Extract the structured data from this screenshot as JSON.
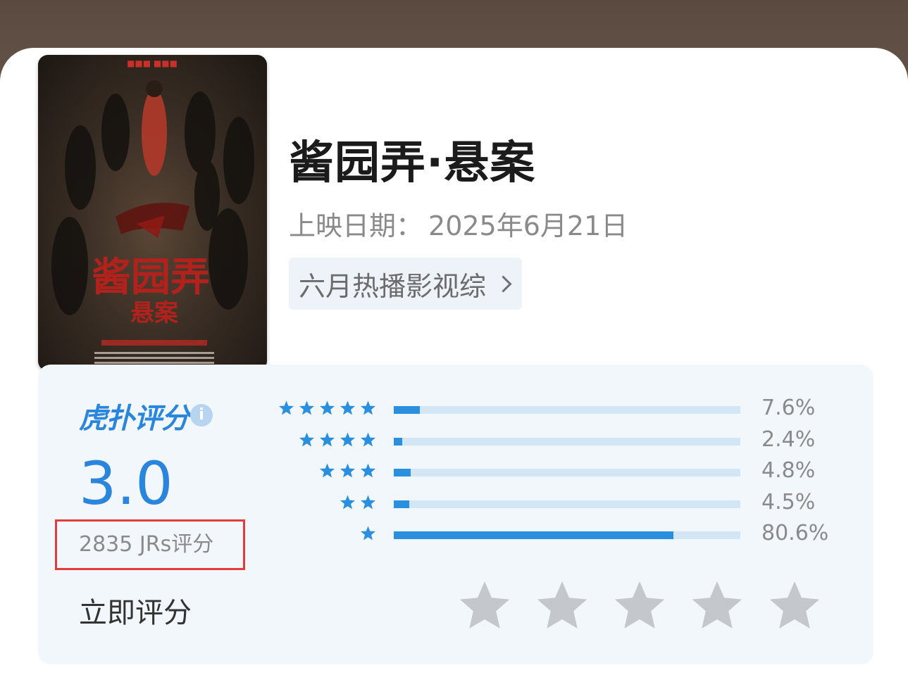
{
  "movie": {
    "title": "酱园弄·悬案",
    "release_label": "上映日期：",
    "release_date": "2025年6月21日",
    "tag": "六月热播影视综",
    "poster_alt": "酱园弄 悬案"
  },
  "rating": {
    "brand": "虎扑评分",
    "brand_mark": "®",
    "info_icon": "i",
    "score": "3.0",
    "count": "2835 JRs评分",
    "rate_now": "立即评分",
    "distribution": [
      {
        "stars": 5,
        "percent": "7.6%",
        "fraction": 0.076
      },
      {
        "stars": 4,
        "percent": "2.4%",
        "fraction": 0.024
      },
      {
        "stars": 3,
        "percent": "4.8%",
        "fraction": 0.048
      },
      {
        "stars": 2,
        "percent": "4.5%",
        "fraction": 0.045
      },
      {
        "stars": 1,
        "percent": "80.6%",
        "fraction": 0.806
      }
    ],
    "user_stars": 0,
    "user_stars_max": 5
  },
  "colors": {
    "accent": "#2a86dc",
    "bar_fill": "#2a8fde",
    "bar_track": "#d2e6f6",
    "star_blue": "#2a8fde",
    "star_gray": "#c4c7cc",
    "highlight_box": "#e23c3c"
  }
}
